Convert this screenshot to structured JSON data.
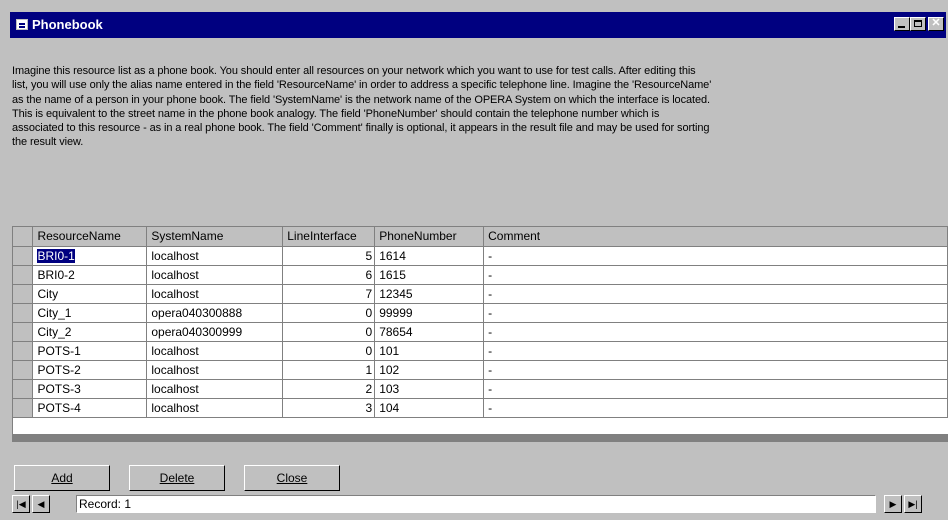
{
  "window": {
    "title": "Phonebook"
  },
  "description": "Imagine this resource list as a phone book. You should enter all resources on your network which you want to use for test calls. After editing this list, you will use only the alias name entered in the field 'ResourceName' in order to address a specific telephone line. Imagine the 'ResourceName' as the name of a person in your phone book. The field 'SystemName' is the network name of the OPERA System on which the interface is located. This is equivalent to the street name in the phone book analogy. The field 'PhoneNumber' should contain the telephone number which is associated to this resource - as in a real phone book. The field 'Comment' finally is optional, it appears in the result file and may be used for sorting the result view.",
  "grid": {
    "columns": [
      "ResourceName",
      "SystemName",
      "LineInterface",
      "PhoneNumber",
      "Comment"
    ],
    "rows": [
      {
        "resource": "BRI0-1",
        "system": "localhost",
        "line": "5",
        "phone": "1614",
        "comment": "-"
      },
      {
        "resource": "BRI0-2",
        "system": "localhost",
        "line": "6",
        "phone": "1615",
        "comment": "-"
      },
      {
        "resource": "City",
        "system": "localhost",
        "line": "7",
        "phone": "12345",
        "comment": "-"
      },
      {
        "resource": "City_1",
        "system": "opera040300888",
        "line": "0",
        "phone": "99999",
        "comment": "-"
      },
      {
        "resource": "City_2",
        "system": "opera040300999",
        "line": "0",
        "phone": "78654",
        "comment": "-"
      },
      {
        "resource": "POTS-1",
        "system": "localhost",
        "line": "0",
        "phone": "101",
        "comment": "-"
      },
      {
        "resource": "POTS-2",
        "system": "localhost",
        "line": "1",
        "phone": "102",
        "comment": "-"
      },
      {
        "resource": "POTS-3",
        "system": "localhost",
        "line": "2",
        "phone": "103",
        "comment": "-"
      },
      {
        "resource": "POTS-4",
        "system": "localhost",
        "line": "3",
        "phone": "104",
        "comment": "-"
      }
    ]
  },
  "buttons": {
    "add": "Add",
    "delete": "Delete",
    "close": "Close"
  },
  "navigator": {
    "record_label": "Record: 1"
  },
  "colors": {
    "titlebar": "#000080",
    "face": "#c0c0c0",
    "selection": "#000080"
  }
}
